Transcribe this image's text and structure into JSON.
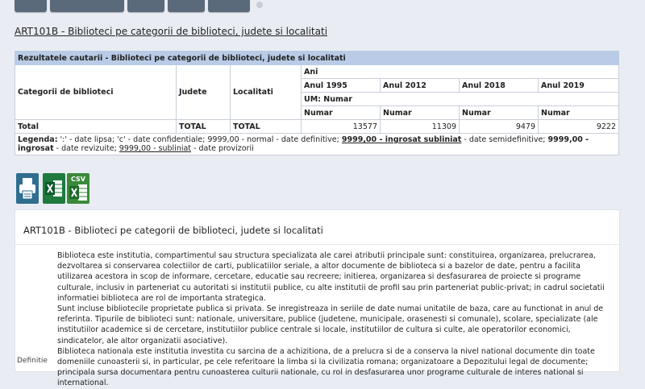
{
  "page": {
    "title": "ART101B - Biblioteci pe categorii de biblioteci, judete si localitati"
  },
  "results": {
    "header": "Rezultatele cautarii - Biblioteci pe categorii de biblioteci, judete si localitati",
    "col_categorie": "Categorii de biblioteci",
    "col_judete": "Judete",
    "col_localitati": "Localitati",
    "col_ani": "Ani",
    "years": [
      "Anul 1995",
      "Anul 2012",
      "Anul 2018",
      "Anul 2019"
    ],
    "um": "UM: Numar",
    "units": [
      "Numar",
      "Numar",
      "Numar",
      "Numar"
    ],
    "row_total": {
      "label": "Total",
      "judet": "TOTAL",
      "localitate": "TOTAL",
      "values": [
        "13577",
        "11309",
        "9479",
        "9222"
      ]
    },
    "legend": {
      "label": "Legenda:",
      "t1": " ':' - date lipsa; 'c' - date confidentiale; 9999,00 - normal - date definitive; ",
      "s1": "9999,00 - ingrosat subliniat",
      "t2": " - date semidefinitive; ",
      "s2": "9999,00 - ingrosat",
      "t3": " - date revizuite; ",
      "s3": "9999,00 - subliniat",
      "t4": " - date provizorii"
    }
  },
  "icons": {
    "print": "print-icon",
    "xls": "excel-icon",
    "csv_label": "CSV"
  },
  "details": {
    "title": "ART101B - Biblioteci pe categorii de biblioteci, judete si localitati",
    "definition_label": "Definitie",
    "p1": "Biblioteca este institutia, compartimentul sau structura specializata ale carei atributii principale sunt: constituirea, organizarea, prelucrarea, dezvoltarea si conservarea colectiilor de carti, publicatiilor seriale, a altor documente de biblioteca si a bazelor de date, pentru a facilita utilizarea acestora in scop de informare, cercetare, educatie sau recreere; initierea, organizarea si desfasurarea de proiecte si programe culturale, inclusiv in parteneriat cu autoritati si institutii publice, cu alte institutii de profil sau prin parteneriat public-privat; in cadrul societatii informatiei biblioteca are rol de importanta strategica.",
    "p2": "Sunt incluse bibliotecile proprietate publica si privata. Se inregistreaza in seriile de date numai unitatile de baza, care au functionat in anul de referinta. Tipurile de biblioteci sunt: nationale, universitare, publice (judetene, municipale, orasenesti si comunale), scolare, specializate (ale institutiilor academice si de cercetare, institutiilor publice centrale si locale, institutiilor de cultura si culte, ale operatorilor economici, sindicatelor, ale altor organizatii asociative).",
    "p3": "Biblioteca nationala este institutia investita cu sarcina de a achizitiona, de a prelucra si de a conserva la nivel national documente din toate domeniile cunoasterii si, in particular, pe cele referitoare la limba si la civilizatia romana; organizatoare a Depozitului legal de documente; principala sursa documentara pentru cunoasterea culturii nationale, cu rol in desfasurarea unor programe culturale de interes national si international."
  },
  "colors": {
    "header_bg": "#b9cbe6",
    "tab_bg": "#5b6a7a",
    "page_bg": "#e9edf3"
  }
}
